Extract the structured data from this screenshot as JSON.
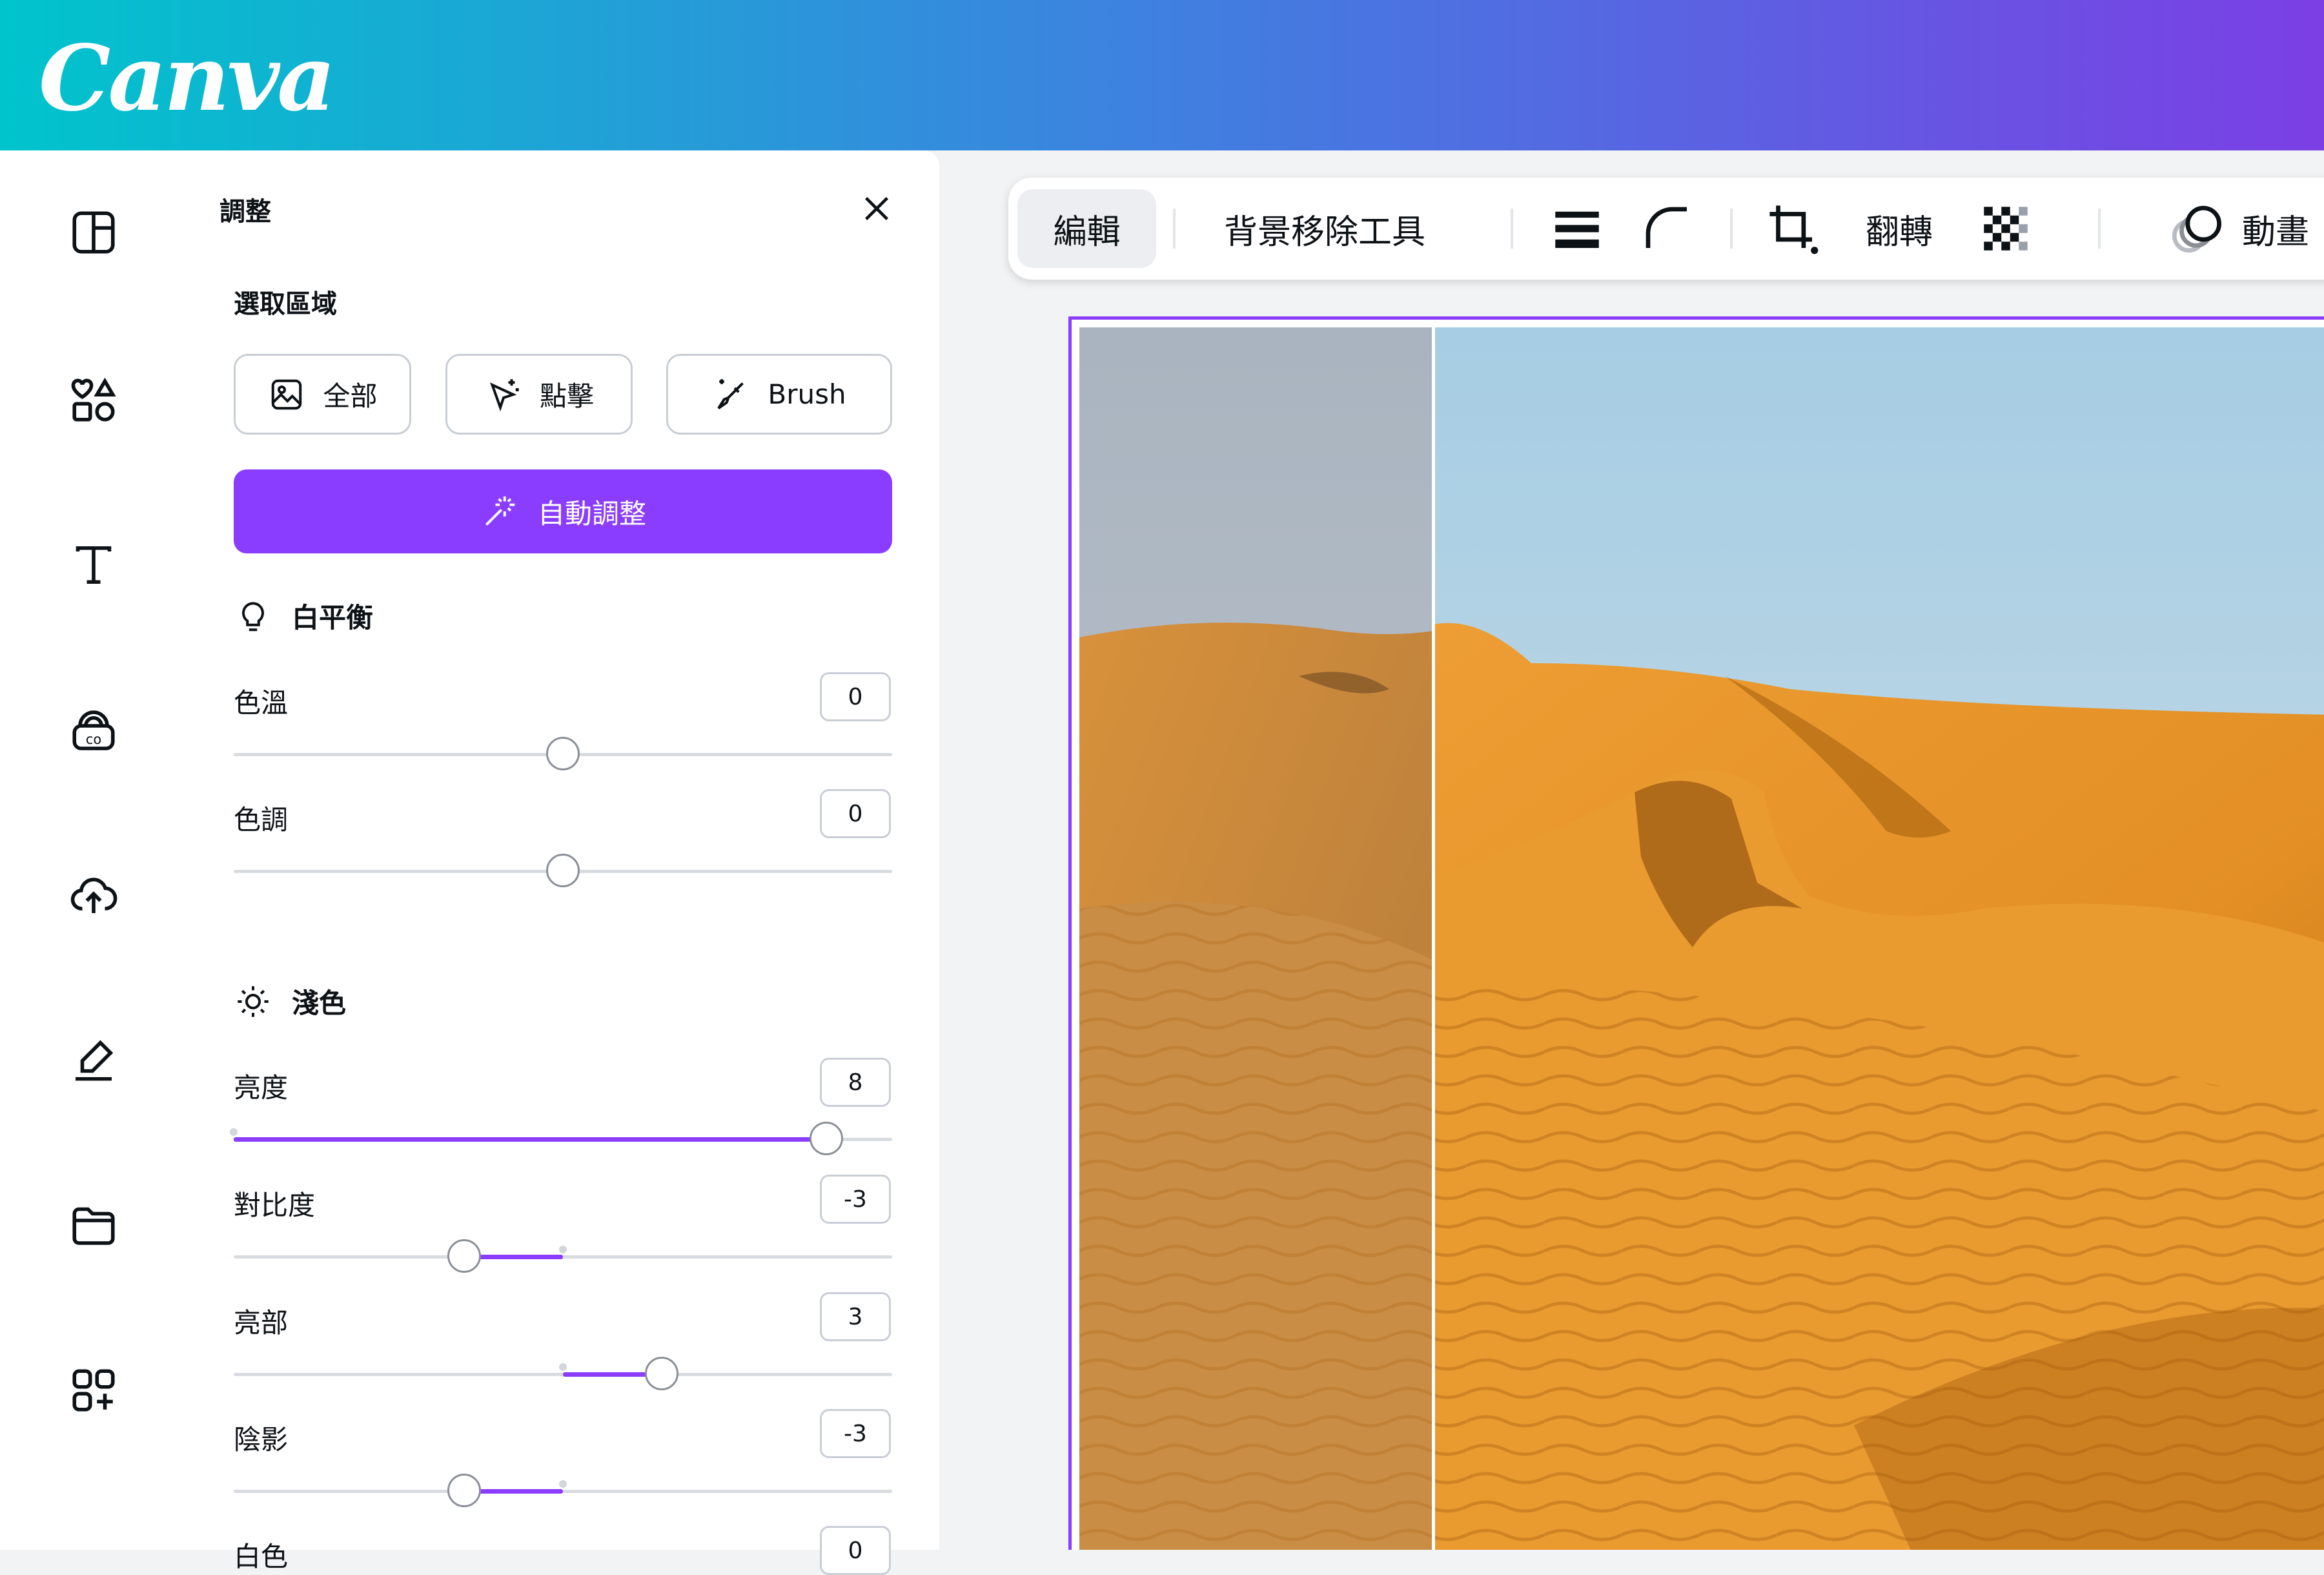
{
  "app": {
    "logo": "Canva"
  },
  "panel": {
    "title": "調整",
    "selection_title": "選取區域",
    "selection_buttons": [
      {
        "label": "全部",
        "icon": "image-icon"
      },
      {
        "label": "點擊",
        "icon": "magic-pointer-icon"
      },
      {
        "label": "Brush",
        "icon": "magic-brush-icon"
      }
    ],
    "auto_adjust": "自動調整",
    "white_balance": {
      "title": "白平衡",
      "sliders": [
        {
          "label": "色溫",
          "value": "0",
          "level": 0
        },
        {
          "label": "色調",
          "value": "0",
          "level": 0
        }
      ]
    },
    "light": {
      "title": "淺色",
      "sliders": [
        {
          "label": "亮度",
          "value": "8",
          "level": 8
        },
        {
          "label": "對比度",
          "value": "-3",
          "level": -3
        },
        {
          "label": "亮部",
          "value": "3",
          "level": 3
        },
        {
          "label": "陰影",
          "value": "-3",
          "level": -3
        },
        {
          "label": "白色",
          "value": "0",
          "level": 0
        }
      ]
    }
  },
  "toolbar": {
    "edit": "編輯",
    "bg_remover": "背景移除工具",
    "flip": "翻轉",
    "animate": "動畫",
    "icons": [
      "lines-icon",
      "corner-radius-icon",
      "crop-icon",
      "transparency-icon",
      "animate-icon"
    ]
  },
  "rail_icons": [
    "design-icon",
    "elements-icon",
    "text-icon",
    "brand-icon",
    "uploads-icon",
    "draw-icon",
    "projects-icon",
    "apps-icon"
  ],
  "colors": {
    "accent": "#8b3dff",
    "gradient_start": "#00c4cc",
    "gradient_end": "#7b3fe4"
  }
}
